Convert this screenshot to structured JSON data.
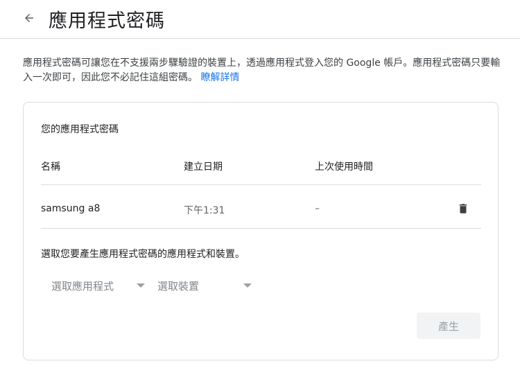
{
  "header": {
    "back_icon": "arrow-back-icon",
    "title": "應用程式密碼"
  },
  "description": {
    "text": "應用程式密碼可讓您在不支援兩步驟驗證的裝置上，透過應用程式登入您的 Google 帳戶。應用程式密碼只要輸入一次即可，因此您不必記住這組密碼。",
    "link": "瞭解詳情"
  },
  "card": {
    "title": "您的應用程式密碼",
    "columns": [
      "名稱",
      "建立日期",
      "上次使用時間"
    ],
    "rows": [
      {
        "name": "samsung a8",
        "created": "下午1:31",
        "last_used": "–",
        "action_icon": "trash-icon"
      }
    ],
    "select_prompt": "選取您要產生應用程式密碼的應用程式和裝置。",
    "select_app": {
      "value": "選取應用程式"
    },
    "select_device": {
      "value": "選取裝置"
    },
    "generate_label": "產生"
  },
  "colors": {
    "link": "#1a73e8",
    "divider": "#dadce0",
    "disabled_button_bg": "#f1f3f4",
    "disabled_button_text": "#9aa0a6"
  }
}
